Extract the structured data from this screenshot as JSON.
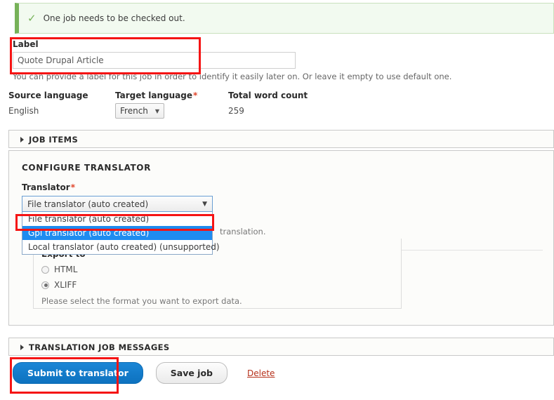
{
  "status": {
    "icon": "check-icon",
    "message": "One job needs to be checked out."
  },
  "label_field": {
    "label": "Label",
    "value": "Quote Drupal Article",
    "placeholder": "",
    "description": "You can provide a label for this job in order to identify it easily later on. Or leave it empty to use default one."
  },
  "languages": {
    "source": {
      "heading": "Source language",
      "value": "English"
    },
    "target": {
      "heading": "Target language",
      "required_marker": "*",
      "value": "French",
      "caret": "chevron-down-icon"
    },
    "word_count": {
      "heading": "Total word count",
      "value": "259"
    }
  },
  "job_items": {
    "legend": "JOB ITEMS",
    "expander": "triangle-right-icon"
  },
  "configure_translator": {
    "title": "CONFIGURE TRANSLATOR",
    "translator_field": {
      "label": "Translator",
      "required_marker": "*",
      "selected": "File translator (auto created)",
      "caret": "chevron-down-icon",
      "options": [
        {
          "label": "File translator (auto created)",
          "selected": false
        },
        {
          "label": "Gpi translator (auto created)",
          "selected": true
        },
        {
          "label": "Local translator (auto created) (unsupported)",
          "selected": false
        }
      ],
      "description_tail": "translation."
    },
    "export": {
      "title": "Export to",
      "options": [
        {
          "label": "HTML",
          "checked": false
        },
        {
          "label": "XLIFF",
          "checked": true
        }
      ],
      "description": "Please select the format you want to export data."
    }
  },
  "messages_fieldset": {
    "legend": "TRANSLATION JOB MESSAGES",
    "expander": "triangle-right-icon"
  },
  "actions": {
    "submit_label": "Submit to translator",
    "save_label": "Save job",
    "delete_label": "Delete"
  },
  "colors": {
    "status_bg": "#f2faf0",
    "status_border": "#77b259",
    "highlight_blue": "#1f8cf0",
    "primary_button": "#0d72bf",
    "annotation_red": "#f51414",
    "required_red": "#e0452a",
    "delete_link": "#b6301a"
  }
}
